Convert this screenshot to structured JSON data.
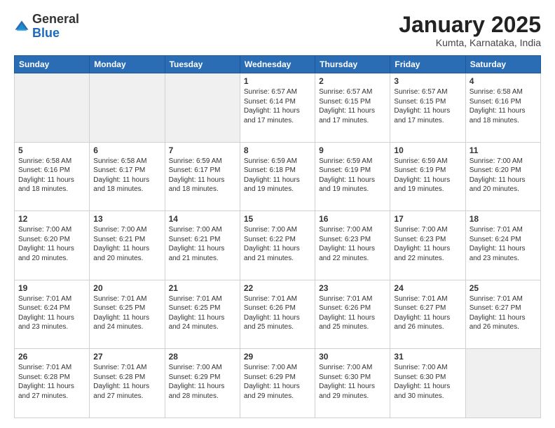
{
  "logo": {
    "general": "General",
    "blue": "Blue"
  },
  "title": "January 2025",
  "subtitle": "Kumta, Karnataka, India",
  "weekdays": [
    "Sunday",
    "Monday",
    "Tuesday",
    "Wednesday",
    "Thursday",
    "Friday",
    "Saturday"
  ],
  "weeks": [
    [
      {
        "day": "",
        "info": ""
      },
      {
        "day": "",
        "info": ""
      },
      {
        "day": "",
        "info": ""
      },
      {
        "day": "1",
        "info": "Sunrise: 6:57 AM\nSunset: 6:14 PM\nDaylight: 11 hours\nand 17 minutes."
      },
      {
        "day": "2",
        "info": "Sunrise: 6:57 AM\nSunset: 6:15 PM\nDaylight: 11 hours\nand 17 minutes."
      },
      {
        "day": "3",
        "info": "Sunrise: 6:57 AM\nSunset: 6:15 PM\nDaylight: 11 hours\nand 17 minutes."
      },
      {
        "day": "4",
        "info": "Sunrise: 6:58 AM\nSunset: 6:16 PM\nDaylight: 11 hours\nand 18 minutes."
      }
    ],
    [
      {
        "day": "5",
        "info": "Sunrise: 6:58 AM\nSunset: 6:16 PM\nDaylight: 11 hours\nand 18 minutes."
      },
      {
        "day": "6",
        "info": "Sunrise: 6:58 AM\nSunset: 6:17 PM\nDaylight: 11 hours\nand 18 minutes."
      },
      {
        "day": "7",
        "info": "Sunrise: 6:59 AM\nSunset: 6:17 PM\nDaylight: 11 hours\nand 18 minutes."
      },
      {
        "day": "8",
        "info": "Sunrise: 6:59 AM\nSunset: 6:18 PM\nDaylight: 11 hours\nand 19 minutes."
      },
      {
        "day": "9",
        "info": "Sunrise: 6:59 AM\nSunset: 6:19 PM\nDaylight: 11 hours\nand 19 minutes."
      },
      {
        "day": "10",
        "info": "Sunrise: 6:59 AM\nSunset: 6:19 PM\nDaylight: 11 hours\nand 19 minutes."
      },
      {
        "day": "11",
        "info": "Sunrise: 7:00 AM\nSunset: 6:20 PM\nDaylight: 11 hours\nand 20 minutes."
      }
    ],
    [
      {
        "day": "12",
        "info": "Sunrise: 7:00 AM\nSunset: 6:20 PM\nDaylight: 11 hours\nand 20 minutes."
      },
      {
        "day": "13",
        "info": "Sunrise: 7:00 AM\nSunset: 6:21 PM\nDaylight: 11 hours\nand 20 minutes."
      },
      {
        "day": "14",
        "info": "Sunrise: 7:00 AM\nSunset: 6:21 PM\nDaylight: 11 hours\nand 21 minutes."
      },
      {
        "day": "15",
        "info": "Sunrise: 7:00 AM\nSunset: 6:22 PM\nDaylight: 11 hours\nand 21 minutes."
      },
      {
        "day": "16",
        "info": "Sunrise: 7:00 AM\nSunset: 6:23 PM\nDaylight: 11 hours\nand 22 minutes."
      },
      {
        "day": "17",
        "info": "Sunrise: 7:00 AM\nSunset: 6:23 PM\nDaylight: 11 hours\nand 22 minutes."
      },
      {
        "day": "18",
        "info": "Sunrise: 7:01 AM\nSunset: 6:24 PM\nDaylight: 11 hours\nand 23 minutes."
      }
    ],
    [
      {
        "day": "19",
        "info": "Sunrise: 7:01 AM\nSunset: 6:24 PM\nDaylight: 11 hours\nand 23 minutes."
      },
      {
        "day": "20",
        "info": "Sunrise: 7:01 AM\nSunset: 6:25 PM\nDaylight: 11 hours\nand 24 minutes."
      },
      {
        "day": "21",
        "info": "Sunrise: 7:01 AM\nSunset: 6:25 PM\nDaylight: 11 hours\nand 24 minutes."
      },
      {
        "day": "22",
        "info": "Sunrise: 7:01 AM\nSunset: 6:26 PM\nDaylight: 11 hours\nand 25 minutes."
      },
      {
        "day": "23",
        "info": "Sunrise: 7:01 AM\nSunset: 6:26 PM\nDaylight: 11 hours\nand 25 minutes."
      },
      {
        "day": "24",
        "info": "Sunrise: 7:01 AM\nSunset: 6:27 PM\nDaylight: 11 hours\nand 26 minutes."
      },
      {
        "day": "25",
        "info": "Sunrise: 7:01 AM\nSunset: 6:27 PM\nDaylight: 11 hours\nand 26 minutes."
      }
    ],
    [
      {
        "day": "26",
        "info": "Sunrise: 7:01 AM\nSunset: 6:28 PM\nDaylight: 11 hours\nand 27 minutes."
      },
      {
        "day": "27",
        "info": "Sunrise: 7:01 AM\nSunset: 6:28 PM\nDaylight: 11 hours\nand 27 minutes."
      },
      {
        "day": "28",
        "info": "Sunrise: 7:00 AM\nSunset: 6:29 PM\nDaylight: 11 hours\nand 28 minutes."
      },
      {
        "day": "29",
        "info": "Sunrise: 7:00 AM\nSunset: 6:29 PM\nDaylight: 11 hours\nand 29 minutes."
      },
      {
        "day": "30",
        "info": "Sunrise: 7:00 AM\nSunset: 6:30 PM\nDaylight: 11 hours\nand 29 minutes."
      },
      {
        "day": "31",
        "info": "Sunrise: 7:00 AM\nSunset: 6:30 PM\nDaylight: 11 hours\nand 30 minutes."
      },
      {
        "day": "",
        "info": ""
      }
    ]
  ]
}
